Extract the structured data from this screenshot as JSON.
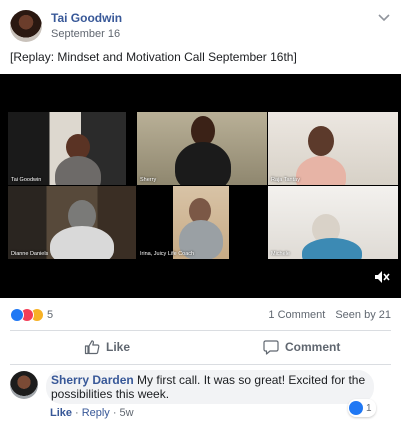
{
  "post": {
    "author": "Tai Goodwin",
    "date": "September 16",
    "text": "[Replay: Mindset and Motivation Call September 16th]"
  },
  "video": {
    "participants": [
      "Tai Goodwin",
      "Sherry",
      "Raja Tantay",
      "Dianne Daniels",
      "Irina, Juicy Life Coach",
      "Michele"
    ]
  },
  "stats": {
    "reaction_count": "5",
    "comments": "1 Comment",
    "seen": "Seen by 21"
  },
  "actions": {
    "like_label": "Like",
    "comment_label": "Comment"
  },
  "comment": {
    "author": "Sherry Darden",
    "text": "My first call. It was so great! Excited for the possibilities this week.",
    "like_label": "Like",
    "reply_label": "Reply",
    "time": "5w",
    "reaction_count": "1"
  },
  "colors": {
    "link": "#385898",
    "muted": "#606770",
    "like_blue": "#2078f4"
  }
}
